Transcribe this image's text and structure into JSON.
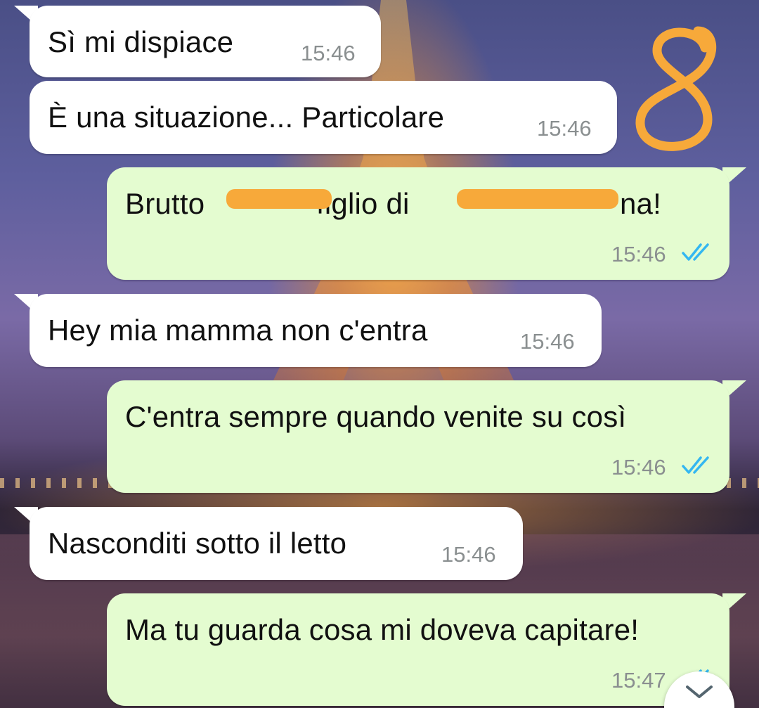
{
  "app": "WhatsApp",
  "annotation": "8",
  "colors": {
    "incoming_bubble": "#ffffff",
    "outgoing_bubble": "#e4fcd0",
    "time_text": "#8a8f90",
    "read_ticks": "#34b7f1",
    "redaction": "#f7a93a"
  },
  "messages": [
    {
      "direction": "incoming",
      "text": "Sì mi dispiace",
      "time": "15:46"
    },
    {
      "direction": "incoming",
      "text": "È una situazione... Particolare",
      "time": "15:46"
    },
    {
      "direction": "outgoing",
      "text_before": "Brutto ",
      "text_mid": " figlio di",
      "text_after": "na!",
      "time": "15:46",
      "status": "read-double-tick-icon"
    },
    {
      "direction": "incoming",
      "text": "Hey mia mamma non c'entra",
      "time": "15:46"
    },
    {
      "direction": "outgoing",
      "text": "C'entra sempre quando venite su così",
      "time": "15:46",
      "status": "read-double-tick-icon"
    },
    {
      "direction": "incoming",
      "text": "Nasconditi sotto il letto",
      "time": "15:46"
    },
    {
      "direction": "outgoing",
      "text": "Ma tu guarda cosa mi doveva capitare!",
      "time": "15:47",
      "status": "read-double-tick-icon"
    }
  ],
  "scroll_button_icon": "chevron-down-icon"
}
